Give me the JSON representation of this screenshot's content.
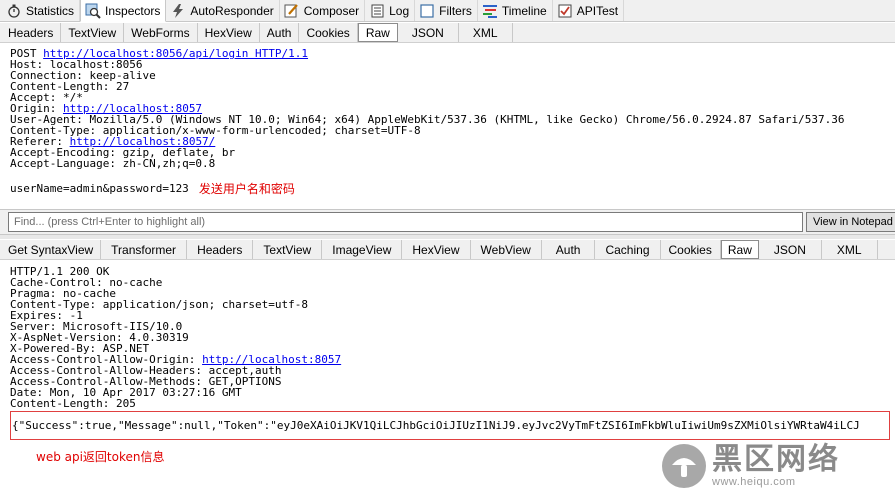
{
  "top_tabs": [
    {
      "label": "Statistics",
      "icon": "stopwatch-icon",
      "active": false
    },
    {
      "label": "Inspectors",
      "icon": "magnifier-icon",
      "active": true
    },
    {
      "label": "AutoResponder",
      "icon": "lightning-icon",
      "active": false
    },
    {
      "label": "Composer",
      "icon": "pencil-icon",
      "active": false
    },
    {
      "label": "Log",
      "icon": "log-icon",
      "active": false
    },
    {
      "label": "Filters",
      "icon": "checkbox-icon",
      "active": false
    },
    {
      "label": "Timeline",
      "icon": "timeline-icon",
      "active": false
    },
    {
      "label": "APITest",
      "icon": "check-icon",
      "active": false
    }
  ],
  "request_tabs": [
    "Headers",
    "TextView",
    "WebForms",
    "HexView",
    "Auth",
    "Cookies",
    "Raw",
    "JSON",
    "XML"
  ],
  "request_active_tab": "Raw",
  "request": {
    "line1_prefix": "POST ",
    "line1_url": "http://localhost:8056/api/login HTTP/1.1",
    "host": "Host: localhost:8056",
    "connection": "Connection: keep-alive",
    "content_length": "Content-Length: 27",
    "accept": "Accept: */*",
    "origin_prefix": "Origin: ",
    "origin_url": "http://localhost:8057",
    "user_agent": "User-Agent: Mozilla/5.0 (Windows NT 10.0; Win64; x64) AppleWebKit/537.36 (KHTML, like Gecko) Chrome/56.0.2924.87 Safari/537.36",
    "content_type": "Content-Type: application/x-www-form-urlencoded; charset=UTF-8",
    "referer_prefix": "Referer: ",
    "referer_url": "http://localhost:8057/",
    "accept_encoding": "Accept-Encoding: gzip, deflate, br",
    "accept_language": "Accept-Language: zh-CN,zh;q=0.8",
    "body": "userName=admin&password=123",
    "body_note": "发送用户名和密码"
  },
  "find": {
    "placeholder": "Find... (press Ctrl+Enter to highlight all)",
    "button": "View in Notepad"
  },
  "response_tabs": [
    "Get SyntaxView",
    "Transformer",
    "Headers",
    "TextView",
    "ImageView",
    "HexView",
    "WebView",
    "Auth",
    "Caching",
    "Cookies",
    "Raw",
    "JSON",
    "XML"
  ],
  "response_active_tab": "Raw",
  "response": {
    "status": "HTTP/1.1 200 OK",
    "cache_control": "Cache-Control: no-cache",
    "pragma": "Pragma: no-cache",
    "content_type": "Content-Type: application/json; charset=utf-8",
    "expires": "Expires: -1",
    "server": "Server: Microsoft-IIS/10.0",
    "aspnet_version": "X-AspNet-Version: 4.0.30319",
    "powered_by": "X-Powered-By: ASP.NET",
    "acao_prefix": "Access-Control-Allow-Origin: ",
    "acao_url": "http://localhost:8057",
    "acah": "Access-Control-Allow-Headers: accept,auth",
    "acam": "Access-Control-Allow-Methods: GET,OPTIONS",
    "date": "Date: Mon, 10 Apr 2017 03:27:16 GMT",
    "content_length": "Content-Length: 205",
    "body": "{\"Success\":true,\"Message\":null,\"Token\":\"eyJ0eXAiOiJKV1QiLCJhbGciOiJIUzI1NiJ9.eyJvc2VyTmFtZSI6ImFkbWluIiwiUm9sZXMiOlsiYWRtaW4iLCJ",
    "body_note": "web api返回token信息"
  },
  "watermark": {
    "title": "黑区网络",
    "url": "www.heiqu.com"
  },
  "colors": {
    "link": "#0000ee",
    "note": "#e00000",
    "highlight_box": "#e04040"
  }
}
